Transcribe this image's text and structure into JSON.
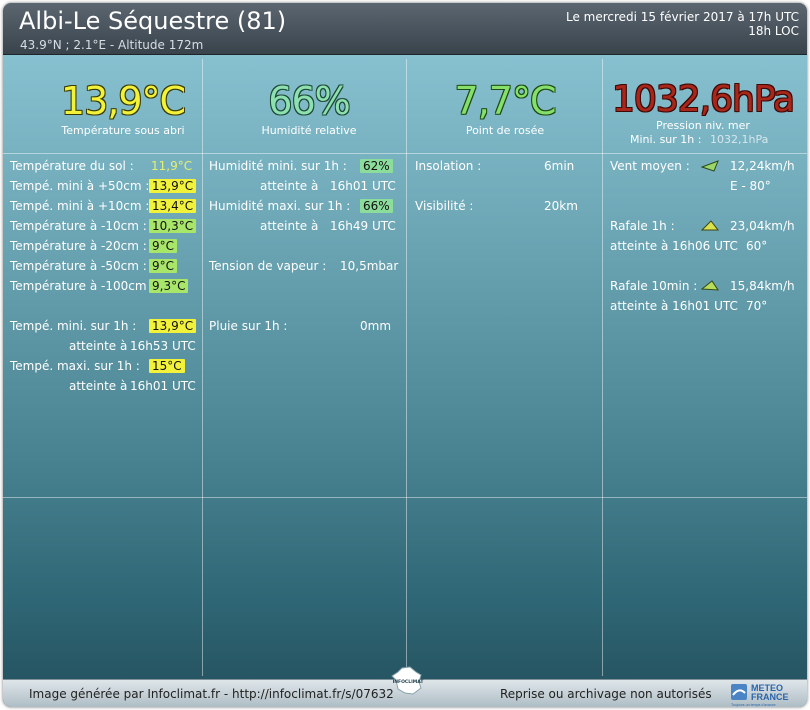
{
  "header": {
    "station": "Albi-Le Séquestre (81)",
    "coords": "43.9°N ; 2.1°E - Altitude 172m",
    "date": "Le mercredi 15 février 2017 à 17h UTC",
    "local": "18h LOC"
  },
  "summary": {
    "temperature": {
      "value": "13,9°C",
      "label": "Température sous abri"
    },
    "humidity": {
      "value": "66%",
      "label": "Humidité relative"
    },
    "dewpoint": {
      "value": "7,7°C",
      "label": "Point de rosée"
    },
    "pressure": {
      "value": "1032,6hPa",
      "label": "Pression niv. mer",
      "min_label": "Mini. sur 1h :",
      "min_value": "1032,1hPa"
    }
  },
  "temperatures": {
    "soil": {
      "label": "Température du sol :",
      "value": "11,9°C"
    },
    "plus50": {
      "label": "Tempé. mini à +50cm :",
      "value": "13,9°C"
    },
    "plus10": {
      "label": "Tempé. mini à +10cm :",
      "value": "13,4°C"
    },
    "minus10": {
      "label": "Température à -10cm :",
      "value": "10,3°C"
    },
    "minus20": {
      "label": "Température à -20cm :",
      "value": "9°C"
    },
    "minus50": {
      "label": "Température à -50cm :",
      "value": "9°C"
    },
    "minus100": {
      "label": "Température à -100cm :",
      "value": "9,3°C"
    },
    "min1h": {
      "label": "Tempé. mini. sur 1h :",
      "value": "13,9°C",
      "reached_label": "atteinte à",
      "time": "16h53 UTC"
    },
    "max1h": {
      "label": "Tempé. maxi. sur 1h :",
      "value": "15°C",
      "reached_label": "atteinte à",
      "time": "16h01 UTC"
    }
  },
  "humidity_panel": {
    "min1h": {
      "label": "Humidité mini. sur 1h :",
      "value": "62%",
      "reached_label": "atteinte à",
      "time": "16h01 UTC"
    },
    "max1h": {
      "label": "Humidité maxi. sur 1h :",
      "value": "66%",
      "reached_label": "atteinte à",
      "time": "16h49 UTC"
    },
    "vapor": {
      "label": "Tension de vapeur :",
      "value": "10,5mbar"
    },
    "rain": {
      "label": "Pluie sur 1h :",
      "value": "0mm"
    }
  },
  "sun_panel": {
    "insolation": {
      "label": "Insolation :",
      "value": "6min"
    },
    "visibility": {
      "label": "Visibilité :",
      "value": "20km"
    }
  },
  "wind_panel": {
    "mean": {
      "label": "Vent moyen :",
      "speed": "12,24km/h",
      "direction": "E - 80°",
      "arrow_deg": 80
    },
    "gust1h": {
      "label": "Rafale 1h :",
      "speed": "23,04km/h",
      "reached": "atteinte à 16h06 UTC",
      "dir": "60°",
      "arrow_deg": 60
    },
    "gust10": {
      "label": "Rafale 10min :",
      "speed": "15,84km/h",
      "reached": "atteinte à 16h01 UTC",
      "dir": "70°",
      "arrow_deg": 70
    }
  },
  "footer": {
    "left": "Image générée par Infoclimat.fr - http://infoclimat.fr/s/07632",
    "right": "Reprise ou archivage non autorisés",
    "france_logo_text": "INFOCLIMAT",
    "mf_logo": {
      "line1": "METEO",
      "line2": "FRANCE",
      "tagline": "Toujours un temps d'avance"
    }
  },
  "colors": {
    "temp": "#f2f23a",
    "humidity": "#8de0b0",
    "dewpoint": "#84e06a",
    "pressure": "#a8261a"
  }
}
